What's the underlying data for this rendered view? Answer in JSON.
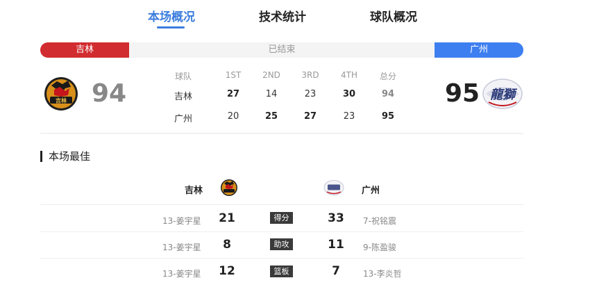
{
  "tabs": [
    {
      "label": "本场概况",
      "active": true
    },
    {
      "label": "技术统计",
      "active": false
    },
    {
      "label": "球队概况",
      "active": false
    }
  ],
  "status": {
    "home_team": "吉林",
    "away_team": "广州",
    "state": "已结束"
  },
  "colors": {
    "accent": "#3b7ddd",
    "home": "#d12c2f",
    "away": "#3d7ff0"
  },
  "scoreboard": {
    "home_score": "94",
    "away_score": "95",
    "headers": [
      "球队",
      "1ST",
      "2ND",
      "3RD",
      "4TH",
      "总分"
    ],
    "rows": [
      {
        "team": "吉林",
        "q": [
          "27",
          "14",
          "23",
          "30"
        ],
        "total": "94"
      },
      {
        "team": "广州",
        "q": [
          "20",
          "25",
          "27",
          "23"
        ],
        "total": "95"
      }
    ]
  },
  "best": {
    "title": "本场最佳",
    "home_team": "吉林",
    "away_team": "广州",
    "rows": [
      {
        "label": "得分",
        "home_player": "13-姜宇星",
        "home_value": "21",
        "away_value": "33",
        "away_player": "7-祝铭震"
      },
      {
        "label": "助攻",
        "home_player": "13-姜宇星",
        "home_value": "8",
        "away_value": "11",
        "away_player": "9-陈盈骏"
      },
      {
        "label": "篮板",
        "home_player": "13-姜宇星",
        "home_value": "12",
        "away_value": "7",
        "away_player": "13-李炎哲"
      }
    ]
  },
  "icons": {
    "home_logo": "jilin-northeast-tigers-logo-icon",
    "away_logo": "guangzhou-loong-lions-logo-icon"
  }
}
